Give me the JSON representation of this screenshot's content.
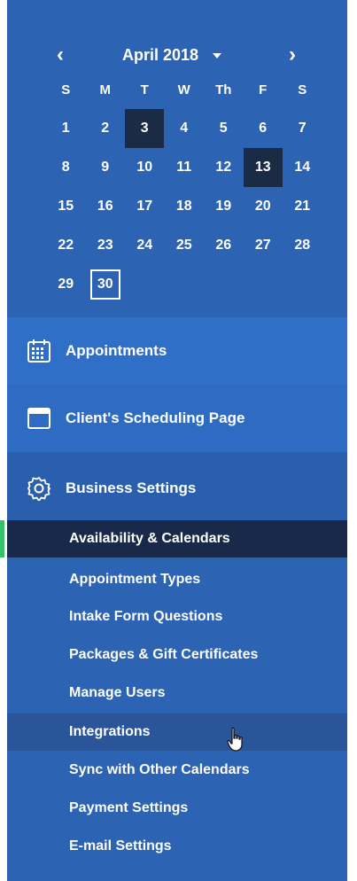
{
  "calendar": {
    "month_label": "April 2018",
    "prev_label": "‹",
    "next_label": "›",
    "weekdays": [
      "S",
      "M",
      "T",
      "W",
      "Th",
      "F",
      "S"
    ],
    "days": [
      "1",
      "2",
      "3",
      "4",
      "5",
      "6",
      "7",
      "8",
      "9",
      "10",
      "11",
      "12",
      "13",
      "14",
      "15",
      "16",
      "17",
      "18",
      "19",
      "20",
      "21",
      "22",
      "23",
      "24",
      "25",
      "26",
      "27",
      "28",
      "29",
      "30"
    ],
    "selected_days": [
      "3",
      "13"
    ],
    "today": "30"
  },
  "nav": {
    "appointments": "Appointments",
    "scheduling_page": "Client's Scheduling Page",
    "business_settings": "Business Settings"
  },
  "business_menu": [
    {
      "label": "Availability & Calendars",
      "state": "active"
    },
    {
      "label": "Appointment Types",
      "state": ""
    },
    {
      "label": "Intake Form Questions",
      "state": ""
    },
    {
      "label": "Packages & Gift Certificates",
      "state": ""
    },
    {
      "label": "Manage Users",
      "state": ""
    },
    {
      "label": "Integrations",
      "state": "hover"
    },
    {
      "label": "Sync with Other Calendars",
      "state": ""
    },
    {
      "label": "Payment Settings",
      "state": ""
    },
    {
      "label": "E-mail Settings",
      "state": ""
    }
  ],
  "colors": {
    "sidebar": "#2c63b3",
    "selected_day": "#1b2a45",
    "active_item": "#18294a",
    "active_accent": "#34c36b"
  }
}
